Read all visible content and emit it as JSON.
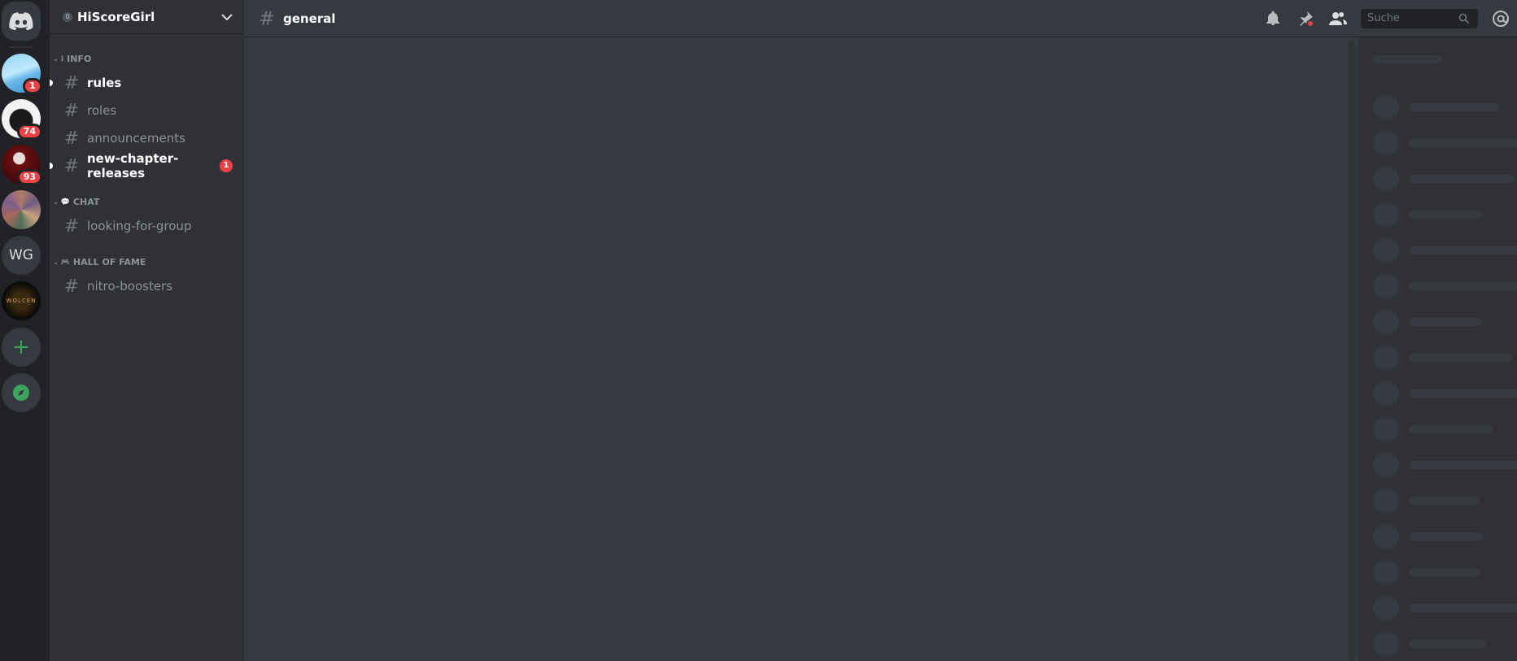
{
  "servers": [
    {
      "name": "home",
      "icon": "discord-logo-icon"
    },
    {
      "name": "server-1",
      "badge": "1"
    },
    {
      "name": "server-2",
      "badge": "74"
    },
    {
      "name": "server-3",
      "badge": "93"
    },
    {
      "name": "server-4"
    },
    {
      "name": "server-wg",
      "label": "WG"
    },
    {
      "name": "server-wolcen",
      "label": "WOLCEN"
    },
    {
      "name": "add-server",
      "label": "+"
    },
    {
      "name": "explore",
      "icon": "compass-icon"
    }
  ],
  "guild": {
    "name": "HiScoreGirl",
    "boost_level": "0"
  },
  "categories": [
    {
      "icon": "ℹ",
      "label": "INFO"
    },
    {
      "icon": "💬",
      "label": "CHAT"
    },
    {
      "icon": "🎮",
      "label": "HALL OF FAME"
    }
  ],
  "channels": [
    {
      "name": "rules",
      "unread": true
    },
    {
      "name": "roles",
      "unread": false
    },
    {
      "name": "announcements",
      "unread": false
    },
    {
      "name": "new-chapter-releases",
      "unread": true,
      "mentions": "1"
    },
    {
      "name": "looking-for-group",
      "unread": false
    },
    {
      "name": "nitro-boosters",
      "unread": false
    }
  ],
  "topbar": {
    "channel": "general",
    "search_placeholder": "Suche",
    "icons": [
      "bell-icon",
      "pin-icon",
      "members-icon",
      "search-icon",
      "mention-icon"
    ]
  },
  "colors": {
    "accent_red": "#ed4245",
    "green": "#3ba55d",
    "bg_main": "#36393f",
    "bg_side": "#2f3136",
    "bg_rail": "#202225"
  }
}
